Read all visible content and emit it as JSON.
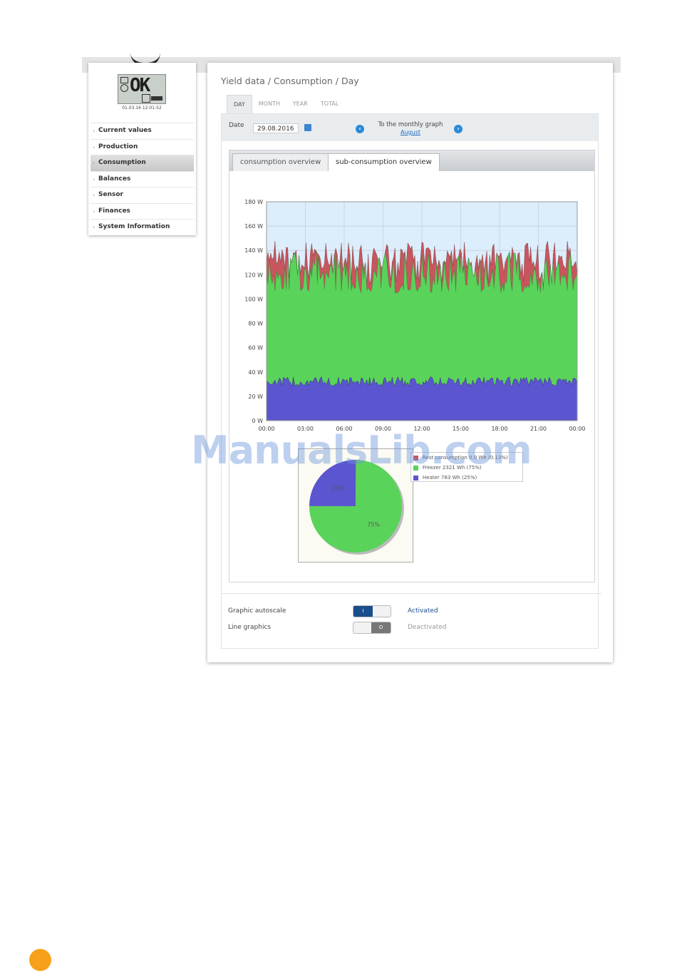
{
  "watermark": "ManualsLib.com",
  "device": {
    "display": "OK",
    "datetime": "01.03.16 12:01:52"
  },
  "sidebar": {
    "items": [
      {
        "label": "Current values",
        "active": false
      },
      {
        "label": "Production",
        "active": false
      },
      {
        "label": "Consumption",
        "active": true
      },
      {
        "label": "Balances",
        "active": false
      },
      {
        "label": "Sensor",
        "active": false
      },
      {
        "label": "Finances",
        "active": false
      },
      {
        "label": "System Information",
        "active": false
      }
    ]
  },
  "main": {
    "title": "Yield data / Consumption / Day",
    "tabs": [
      "DAY",
      "MONTH",
      "YEAR",
      "TOTAL"
    ],
    "active_tab": "DAY",
    "date_label": "Date",
    "date_value": "29.08.2016",
    "monthly_graph_label": "To the monthly graph",
    "monthly_graph_link": "August",
    "subtabs": [
      "consumption overview",
      "sub-consumption overview"
    ],
    "active_subtab": "sub-consumption overview",
    "options": [
      {
        "label": "Graphic autoscale",
        "state": "Activated",
        "toggle": "on",
        "toggle_glyph": "I"
      },
      {
        "label": "Line graphics",
        "state": "Deactivated",
        "toggle": "off",
        "toggle_glyph": "O"
      }
    ]
  },
  "colors": {
    "rest": "#c9555e",
    "freezer": "#5ad35a",
    "heater": "#5b55cf",
    "plot_bg": "#dcedfb",
    "accent": "#1a4d8c"
  },
  "chart_data": [
    {
      "type": "area",
      "stacked": true,
      "y_axis_ticks": [
        "0 W",
        "20 W",
        "40 W",
        "60 W",
        "80 W",
        "100 W",
        "120 W",
        "140 W",
        "160 W",
        "180 W"
      ],
      "x_axis_ticks": [
        "00:00",
        "03:00",
        "06:00",
        "09:00",
        "12:00",
        "15:00",
        "18:00",
        "21:00",
        "00:00"
      ],
      "ylim": [
        0,
        180
      ],
      "series": [
        {
          "name": "Heater",
          "color": "#5b55cf",
          "approx_range": [
            28,
            36
          ]
        },
        {
          "name": "Freezer",
          "color": "#5ad35a",
          "approx_top_range": [
            105,
            140
          ]
        },
        {
          "name": "Rest consumption",
          "color": "#c9555e",
          "approx_top_range": [
            125,
            148
          ]
        }
      ],
      "grid": true
    },
    {
      "type": "pie",
      "slices": [
        {
          "label": "Rest consumption",
          "legend": "Rest consumption 0.0 Wh (0.13%)",
          "value": 0.13,
          "color": "#c9555e"
        },
        {
          "label": "Freezer",
          "legend": "Freezer 2321 Wh (75%)",
          "value": 75,
          "color": "#5ad35a",
          "data_label": "75%"
        },
        {
          "label": "Heater",
          "legend": "Heater 783 Wh (25%)",
          "value": 25,
          "color": "#5b55cf",
          "data_label": "25%"
        }
      ]
    }
  ]
}
